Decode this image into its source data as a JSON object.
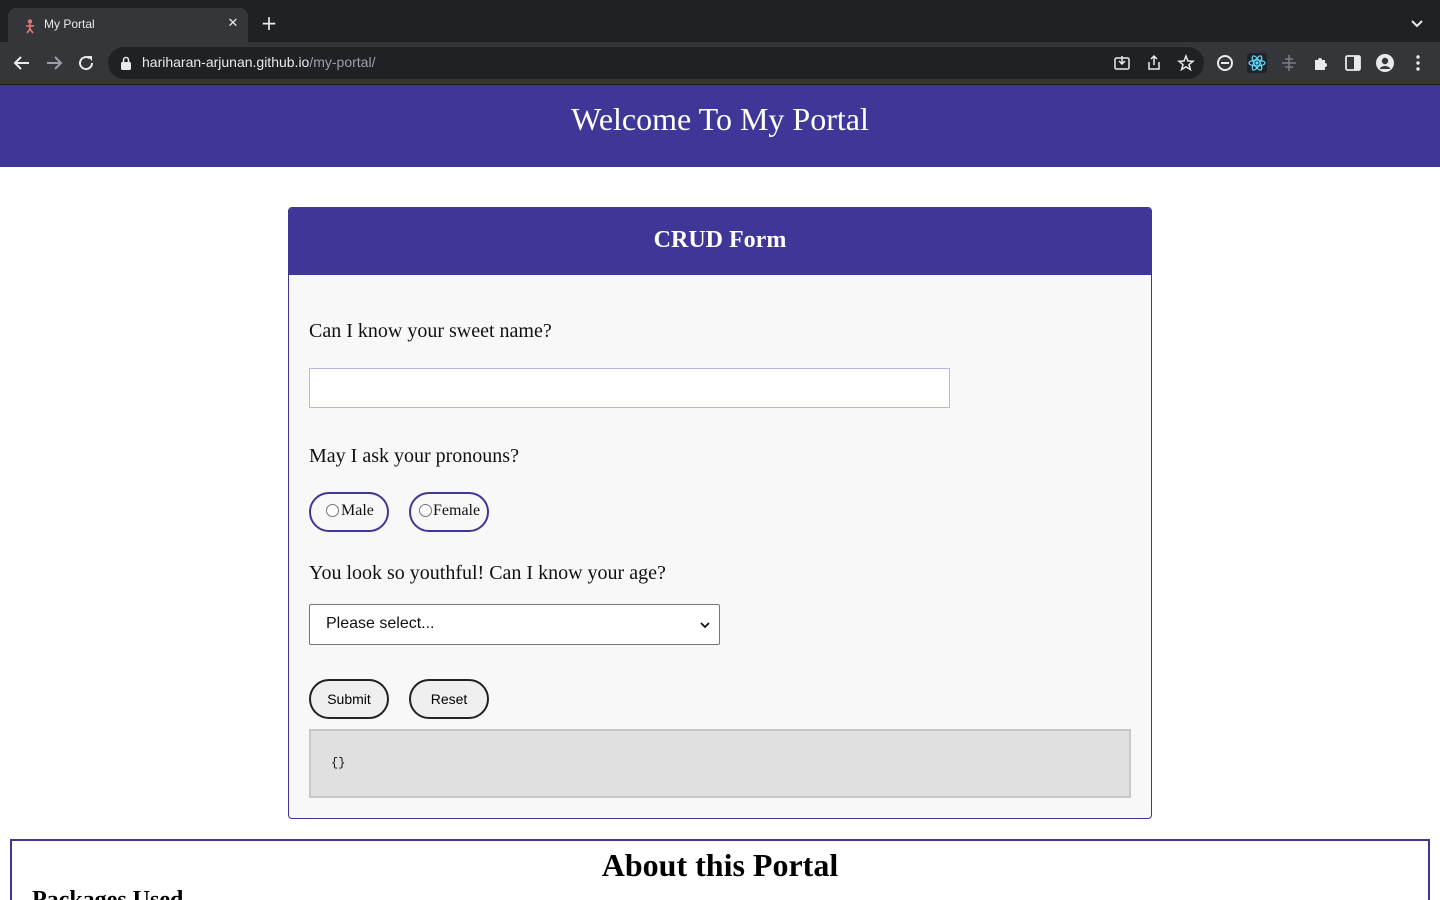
{
  "browser": {
    "tab_title": "My Portal",
    "new_tab_symbol": "+",
    "close_symbol": "✕",
    "url_host": "hariharan-arjunan.github.io",
    "url_path": "/my-portal/",
    "icons": [
      "back-icon",
      "forward-icon",
      "reload-icon",
      "lock-icon",
      "install-icon",
      "share-icon",
      "bookmark-star-icon",
      "edge-extension-icon",
      "react-devtools-icon",
      "ruler-extension-icon",
      "puzzle-extensions-icon",
      "side-panel-icon",
      "profile-icon",
      "menu-icon",
      "tab-list-icon"
    ]
  },
  "page": {
    "title": "Welcome To My Portal",
    "header_color": "#3f3698"
  },
  "form": {
    "title": "CRUD Form",
    "name_question": "Can I know your sweet name?",
    "name_value": "",
    "pronoun_question": "May I ask your pronouns?",
    "pronoun_options": [
      {
        "label": "Male",
        "checked": false
      },
      {
        "label": "Female",
        "checked": false
      }
    ],
    "age_question": "You look so youthful! Can I know your age?",
    "age_selected": "Please select...",
    "submit_label": "Submit",
    "reset_label": "Reset",
    "output": "{}"
  },
  "about": {
    "title": "About this Portal",
    "subtitle": "Packages Used"
  }
}
